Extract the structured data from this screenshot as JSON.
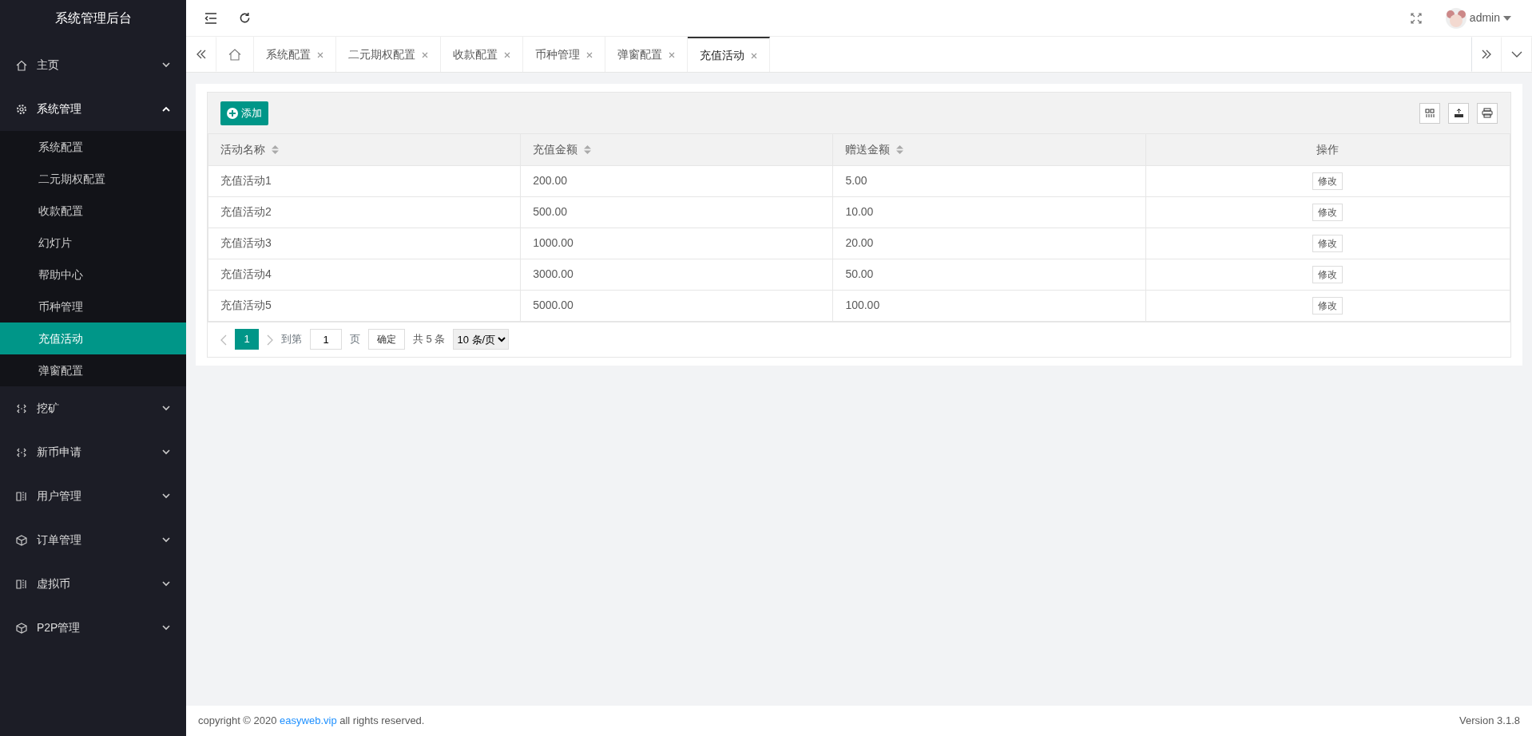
{
  "brand": "系统管理后台",
  "sidebar": {
    "items": [
      {
        "label": "主页",
        "expanded": false
      },
      {
        "label": "系统管理",
        "expanded": true,
        "children": [
          {
            "label": "系统配置",
            "selected": false
          },
          {
            "label": "二元期权配置",
            "selected": false
          },
          {
            "label": "收款配置",
            "selected": false
          },
          {
            "label": "幻灯片",
            "selected": false
          },
          {
            "label": "帮助中心",
            "selected": false
          },
          {
            "label": "币种管理",
            "selected": false
          },
          {
            "label": "充值活动",
            "selected": true
          },
          {
            "label": "弹窗配置",
            "selected": false
          }
        ]
      },
      {
        "label": "挖矿",
        "expanded": false
      },
      {
        "label": "新币申请",
        "expanded": false
      },
      {
        "label": "用户管理",
        "expanded": false
      },
      {
        "label": "订单管理",
        "expanded": false
      },
      {
        "label": "虚拟币",
        "expanded": false
      },
      {
        "label": "P2P管理",
        "expanded": false
      }
    ]
  },
  "header": {
    "user": "admin"
  },
  "tabs": [
    {
      "kind": "home",
      "selected": false
    },
    {
      "kind": "page",
      "label": "系统配置",
      "selected": false
    },
    {
      "kind": "page",
      "label": "二元期权配置",
      "selected": false
    },
    {
      "kind": "page",
      "label": "收款配置",
      "selected": false
    },
    {
      "kind": "page",
      "label": "币种管理",
      "selected": false
    },
    {
      "kind": "page",
      "label": "弹窗配置",
      "selected": false
    },
    {
      "kind": "page",
      "label": "充值活动",
      "selected": true
    }
  ],
  "toolbar": {
    "add_label": "添加"
  },
  "table": {
    "columns": [
      {
        "label": "活动名称",
        "sortable": true
      },
      {
        "label": "充值金额",
        "sortable": true
      },
      {
        "label": "赠送金额",
        "sortable": true
      },
      {
        "label": "操作",
        "sortable": false
      }
    ],
    "rows": [
      {
        "name": "充值活动1",
        "amount": "200.00",
        "bonus": "5.00",
        "action": "修改"
      },
      {
        "name": "充值活动2",
        "amount": "500.00",
        "bonus": "10.00",
        "action": "修改"
      },
      {
        "name": "充值活动3",
        "amount": "1000.00",
        "bonus": "20.00",
        "action": "修改"
      },
      {
        "name": "充值活动4",
        "amount": "3000.00",
        "bonus": "50.00",
        "action": "修改"
      },
      {
        "name": "充值活动5",
        "amount": "5000.00",
        "bonus": "100.00",
        "action": "修改"
      }
    ]
  },
  "pagination": {
    "pages": [
      {
        "label": "1",
        "selected": true
      }
    ],
    "goto_label": "到第",
    "goto_value": "1",
    "page_unit": "页",
    "confirm": "确定",
    "total": "共 5 条",
    "page_size": "10 条/页"
  },
  "footer": {
    "copyright_before": "copyright © 2020",
    "link": "easyweb.vip",
    "copyright_after": "all rights reserved.",
    "version": "Version 3.1.8"
  }
}
